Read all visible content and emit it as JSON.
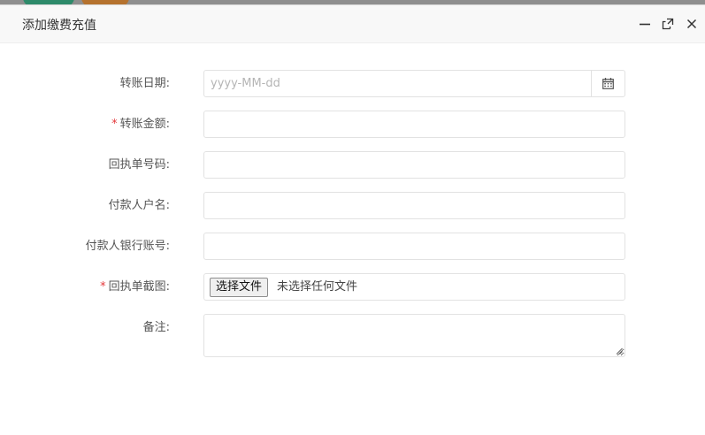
{
  "dialog": {
    "title": "添加缴费充值",
    "controls": {
      "minimize_icon": "minimize-icon",
      "maximize_icon": "maximize-icon",
      "close_icon": "close-icon"
    }
  },
  "form": {
    "transfer_date": {
      "label": "转账日期:",
      "placeholder": "yyyy-MM-dd",
      "value": "",
      "icon": "calendar-icon"
    },
    "amount": {
      "required_mark": "*",
      "label": "转账金额:",
      "value": ""
    },
    "receipt_no": {
      "label": "回执单号码:",
      "value": ""
    },
    "payer_name": {
      "label": "付款人户名:",
      "value": ""
    },
    "payer_account": {
      "label": "付款人银行账号:",
      "value": ""
    },
    "receipt_image": {
      "required_mark": "*",
      "label": "回执单截图:",
      "button_label": "选择文件",
      "status": "未选择任何文件"
    },
    "remark": {
      "label": "备注:",
      "value": ""
    }
  },
  "colors": {
    "required": "#e4393c",
    "titlebar_bg": "#f8f8f8",
    "border": "#e2e2e2"
  }
}
